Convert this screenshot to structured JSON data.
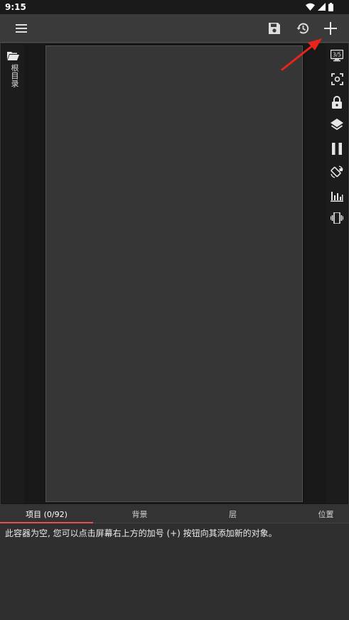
{
  "status_bar": {
    "time": "9:15",
    "icons": [
      "wifi-icon",
      "signal-icon",
      "battery-icon"
    ]
  },
  "toolbar": {
    "menu_icon": "menu-icon",
    "save_icon": "save-icon",
    "history_icon": "history-icon",
    "add_icon": "plus-icon"
  },
  "left_panel": {
    "folder_icon": "folder-open-icon",
    "label": "根目录"
  },
  "right_panel": {
    "counter_label": "3/5",
    "icons": [
      "screen-counter-icon",
      "focus-icon",
      "lock-icon",
      "layers-icon",
      "pause-icon",
      "rotate-icon",
      "equalizer-icon",
      "vibrate-icon"
    ]
  },
  "tabs": [
    {
      "label": "项目 (0/92)",
      "active": true
    },
    {
      "label": "背景",
      "active": false
    },
    {
      "label": "层",
      "active": false
    },
    {
      "label": "位置",
      "active": false
    }
  ],
  "empty_message": "此容器为空, 您可以点击屏幕右上方的加号 (+) 按钮向其添加新的对象。",
  "colors": {
    "accent": "#e0544f",
    "annotation_arrow": "#e8241c"
  }
}
